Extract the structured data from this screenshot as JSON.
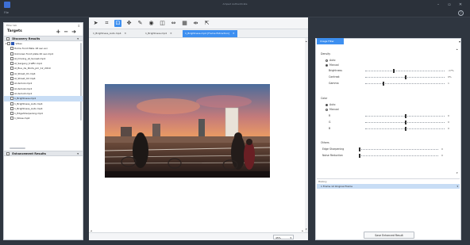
{
  "window": {
    "title": "Amped Authenticate",
    "minimize": "–",
    "maximize": "▫",
    "close": "✕"
  },
  "menubar": {
    "file": "File",
    "help": "?"
  },
  "left_panel": {
    "header": "Filter tab",
    "pin": "⇕",
    "targets_label": "Targets",
    "add": "+",
    "remove": "−",
    "move": "➜",
    "discovery_section": "Discovery Results",
    "enhancement_section": "Enhancement Results",
    "section_arrow": "▾",
    "tree": [
      {
        "label": "Video",
        "folder": true,
        "indent": 0
      },
      {
        "label": "Home front Plate 18 sec.avi",
        "indent": 1
      },
      {
        "label": "Unknown front plate 20 sec.mp4",
        "indent": 1
      },
      {
        "label": "AI_Driving_at_Sunset.mp4",
        "indent": 1
      },
      {
        "label": "AI_Sergeny_traffic.mp4",
        "indent": 1
      },
      {
        "label": "AI_Bus_de_Ponts_pm_12_2019",
        "indent": 1
      },
      {
        "label": "AI_Street_01.mp4",
        "indent": 1
      },
      {
        "label": "AI_Street_02.mp4",
        "indent": 1
      },
      {
        "label": "AI-demo1.mp4",
        "indent": 1
      },
      {
        "label": "AI-demo2.mp4",
        "indent": 1
      },
      {
        "label": "AI-demo3.mp4",
        "indent": 1
      },
      {
        "label": "1_Brightness.mp4",
        "indent": 1,
        "selected": true
      },
      {
        "label": "1_Brightness_Auto.mp4",
        "indent": 1
      },
      {
        "label": "1_Brightness_Auto.mp4",
        "indent": 1
      },
      {
        "label": "1_EdgeSharpening.mp4",
        "indent": 1
      },
      {
        "label": "1_Noise.mp4",
        "indent": 1
      }
    ]
  },
  "toolbar": {
    "tools": [
      {
        "name": "pointer-tool-icon",
        "glyph": "➤"
      },
      {
        "name": "crop-tool-icon",
        "glyph": "⌗"
      },
      {
        "name": "zoom-tool-icon",
        "glyph": "⊡",
        "active": true
      },
      {
        "name": "pan-tool-icon",
        "glyph": "✥"
      },
      {
        "name": "color-picker-icon",
        "glyph": "✎"
      },
      {
        "name": "target-tool-icon",
        "glyph": "◉"
      },
      {
        "name": "frame-tool-icon",
        "glyph": "◫"
      },
      {
        "name": "compare-tool-icon",
        "glyph": "⇔"
      },
      {
        "name": "grid-tool-icon",
        "glyph": "▦"
      },
      {
        "name": "split-tool-icon",
        "glyph": "⇹"
      },
      {
        "name": "scale-tool-icon",
        "glyph": "⇱"
      }
    ]
  },
  "tabs": [
    {
      "label": "1_Brightness_Auto.mp4",
      "close": "✕"
    },
    {
      "label": "1_Brightness.mp4",
      "close": "✕"
    },
    {
      "label": "1_Brightness.mp4 [Frame Extraction]",
      "close": "✕",
      "active": true
    }
  ],
  "viewer": {
    "scroll_up": "▴",
    "scroll_down": "▾",
    "scroll_left": "◂",
    "scroll_right": "▸"
  },
  "statusbar": {
    "zoom": "45%",
    "zoom_arrow": "▾"
  },
  "right_panel": {
    "tab_label": "Image Filter",
    "close": "▾",
    "density_label": "Density",
    "density_auto": "Auto",
    "density_manual": "Manual",
    "brightness": {
      "label": "Brightness",
      "value": "-17%",
      "level": 0.35
    },
    "contrast": {
      "label": "Contrast",
      "value": "0%",
      "level": 0.5
    },
    "gamma": {
      "label": "Gamma",
      "value": "1",
      "level": 0.22
    },
    "color_label": "Color",
    "color_auto": "Auto",
    "color_manual": "Manual",
    "r": {
      "label": "R",
      "value": "0",
      "level": 0.5
    },
    "g": {
      "label": "G",
      "value": "0",
      "level": 0.5
    },
    "b": {
      "label": "B",
      "value": "0",
      "level": 0.5
    },
    "others_label": "Others",
    "edge": {
      "label": "Edge Sharpening",
      "value": "0",
      "level": 0.0
    },
    "noise": {
      "label": "Noise Reduction",
      "value": "0",
      "level": 0.0
    },
    "history_label": "History",
    "history_item": "1 Frame 12 Original Frame",
    "history_arrow": "▾",
    "save_button": "Save Enhanced Result",
    "scroll_up": "▴",
    "scroll_down": "▾"
  }
}
